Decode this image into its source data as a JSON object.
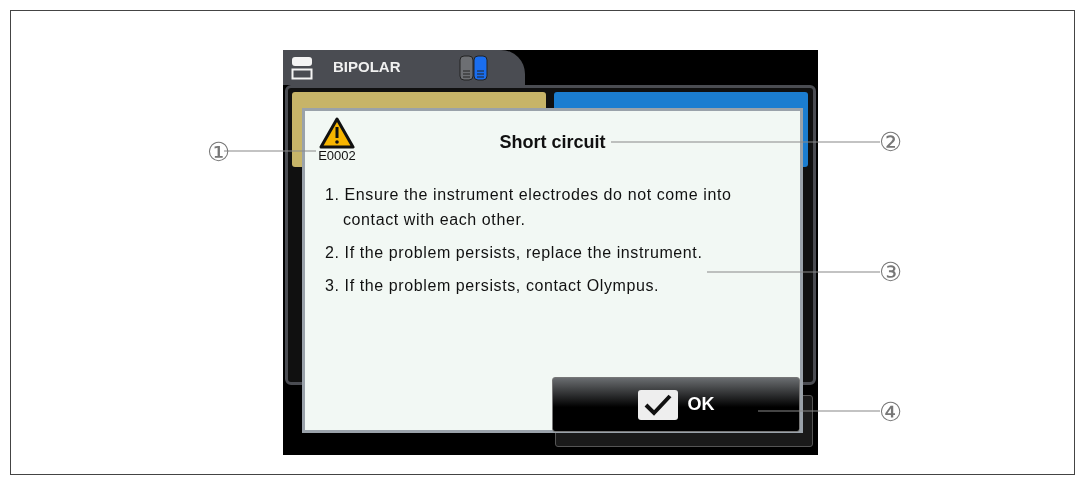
{
  "screen": {
    "mode": "BIPOLAR",
    "tiles": [
      {
        "color": "#c7b468"
      },
      {
        "color": "#1b7dd0"
      }
    ]
  },
  "dialog": {
    "code": "E0002",
    "title": "Short circuit",
    "steps": [
      "1. Ensure the instrument electrodes do not come into contact with each other.",
      "2. If the problem persists, replace the instrument.",
      "3. If the problem persists, contact Olympus."
    ],
    "ok_button": "OK"
  },
  "callouts": [
    {
      "label": "①"
    },
    {
      "label": "②"
    },
    {
      "label": "③"
    },
    {
      "label": "④"
    }
  ]
}
